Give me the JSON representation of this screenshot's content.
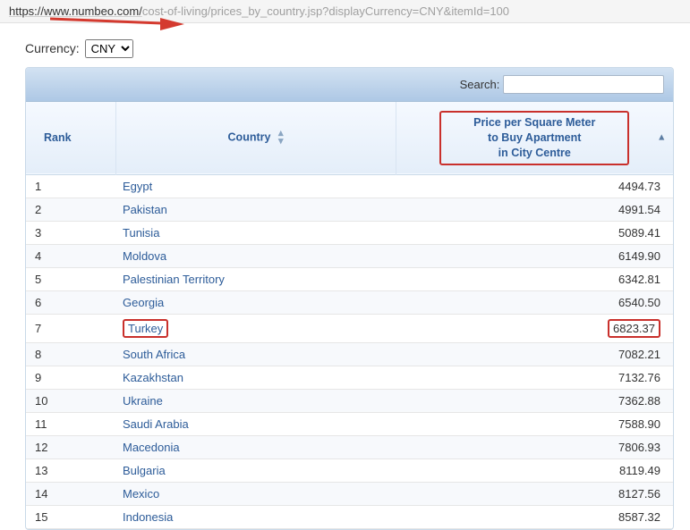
{
  "url": {
    "black": "https://www.numbeo.com/",
    "gray": "cost-of-living/prices_by_country.jsp?displayCurrency=CNY&itemId=100"
  },
  "currency": {
    "label": "Currency:",
    "value": "CNY"
  },
  "search": {
    "label": "Search:",
    "value": ""
  },
  "headers": {
    "rank": "Rank",
    "country": "Country",
    "price_line1": "Price per Square Meter",
    "price_line2": "to Buy Apartment",
    "price_line3": "in City Centre"
  },
  "rows": [
    {
      "rank": "1",
      "country": "Egypt",
      "price": "4494.73"
    },
    {
      "rank": "2",
      "country": "Pakistan",
      "price": "4991.54"
    },
    {
      "rank": "3",
      "country": "Tunisia",
      "price": "5089.41"
    },
    {
      "rank": "4",
      "country": "Moldova",
      "price": "6149.90"
    },
    {
      "rank": "5",
      "country": "Palestinian Territory",
      "price": "6342.81"
    },
    {
      "rank": "6",
      "country": "Georgia",
      "price": "6540.50"
    },
    {
      "rank": "7",
      "country": "Turkey",
      "price": "6823.37",
      "highlight": true
    },
    {
      "rank": "8",
      "country": "South Africa",
      "price": "7082.21"
    },
    {
      "rank": "9",
      "country": "Kazakhstan",
      "price": "7132.76"
    },
    {
      "rank": "10",
      "country": "Ukraine",
      "price": "7362.88"
    },
    {
      "rank": "11",
      "country": "Saudi Arabia",
      "price": "7588.90"
    },
    {
      "rank": "12",
      "country": "Macedonia",
      "price": "7806.93"
    },
    {
      "rank": "13",
      "country": "Bulgaria",
      "price": "8119.49"
    },
    {
      "rank": "14",
      "country": "Mexico",
      "price": "8127.56"
    },
    {
      "rank": "15",
      "country": "Indonesia",
      "price": "8587.32"
    }
  ]
}
